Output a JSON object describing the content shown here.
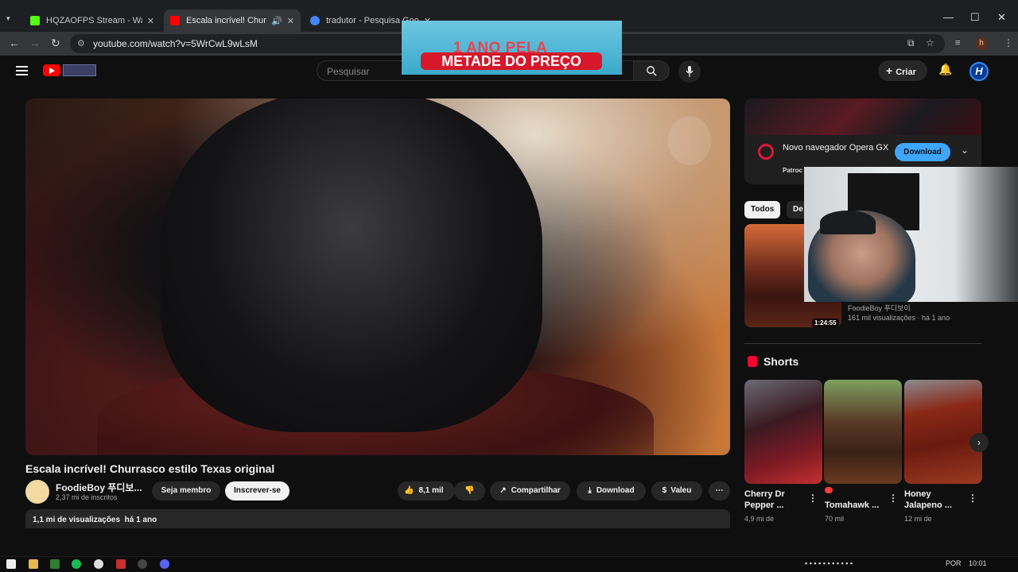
{
  "browser": {
    "tabs": [
      {
        "title": "HQZAOFPS Stream - Watch Liv",
        "color": "#53fc18"
      },
      {
        "title": "Escala incrível! Churrasco e",
        "color": "#ff0000"
      },
      {
        "title": "tradutor - Pesquisa Google",
        "color": "#4285f4"
      }
    ],
    "url": "youtube.com/watch?v=5WrCwL9wLsM",
    "profile_initial": "h"
  },
  "ad_overlay": {
    "line1": "1 ANO PELA",
    "line2": "METADE DO PREÇO"
  },
  "youtube": {
    "search_placeholder": "Pesquisar",
    "create_label": "Criar",
    "avatar_letter": "H"
  },
  "video": {
    "title": "Escala incrível! Churrasco estilo Texas original",
    "channel_name": "FoodieBoy 푸디보...",
    "subscribers": "2,37 mi de inscritos",
    "member_label": "Seja membro",
    "subscribe_label": "Inscrever-se",
    "likes": "8,1 mil",
    "share_label": "Compartilhar",
    "download_label": "Download",
    "thanks_label": "Valeu",
    "views": "1,1 mi de visualizações",
    "age": "há 1 ano"
  },
  "sidebar": {
    "ad": {
      "title": "Novo navegador Opera GX",
      "sponsor": "Patroc",
      "button": "Download"
    },
    "chips": [
      "Todos",
      "De"
    ],
    "recommendation": {
      "duration": "1:24:55",
      "channel": "FoodieBoy 푸디보이",
      "meta": "161 mil visualizações · há 1 ano"
    },
    "shorts_heading": "Shorts",
    "shorts": [
      {
        "title": "Cherry Dr Pepper ...",
        "views": "4,9 mi de"
      },
      {
        "title": "Tomahawk ...",
        "views": "70 mil"
      },
      {
        "title": "Honey Jalapeno ...",
        "views": "12 mi de"
      }
    ]
  },
  "taskbar": {
    "language": "POR",
    "time": "10:01"
  }
}
